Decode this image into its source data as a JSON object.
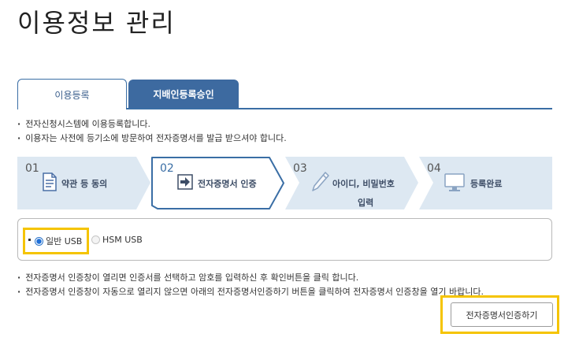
{
  "page_title": "이용정보 관리",
  "tabs": [
    {
      "label": "이용등록",
      "active": true
    },
    {
      "label": "지배인등록승인",
      "active": false
    }
  ],
  "notes_top": [
    "전자신청시스템에 이용등록합니다.",
    "이용자는 사전에 등기소에 방문하여 전자증명서를 발급 받으셔야 합니다."
  ],
  "steps": [
    {
      "number": "01",
      "label": "약관 등 동의",
      "icon": "document-icon",
      "state": "done"
    },
    {
      "number": "02",
      "label": "전자증명서 인증",
      "icon": "arrow-right-icon",
      "state": "current"
    },
    {
      "number": "03",
      "label": "아이디, 비밀번호",
      "label2": "입력",
      "icon": "pencil-icon",
      "state": "todo"
    },
    {
      "number": "04",
      "label": "등록완료",
      "icon": "monitor-icon",
      "state": "todo"
    }
  ],
  "usb_options": [
    {
      "label": "일반 USB",
      "selected": true
    },
    {
      "label": "HSM USB",
      "selected": false
    }
  ],
  "notes_bottom": [
    "전자증명서 인증창이 열리면 인증서를 선택하고 암호를 입력하신 후 확인버튼을 클릭 합니다.",
    "전자증명서 인증창이 자동으로 열리지 않으면 아래의 전자증명서인증하기 버튼을 클릭하여 전자증명서 인증창을 열기 바랍니다."
  ],
  "cert_button_label": "전자증명서인증하기",
  "colors": {
    "accent": "#3a6ea5",
    "tab_inactive_bg": "#3d6aa0",
    "step_bg": "#dde8f2",
    "highlight": "#f5c400"
  }
}
